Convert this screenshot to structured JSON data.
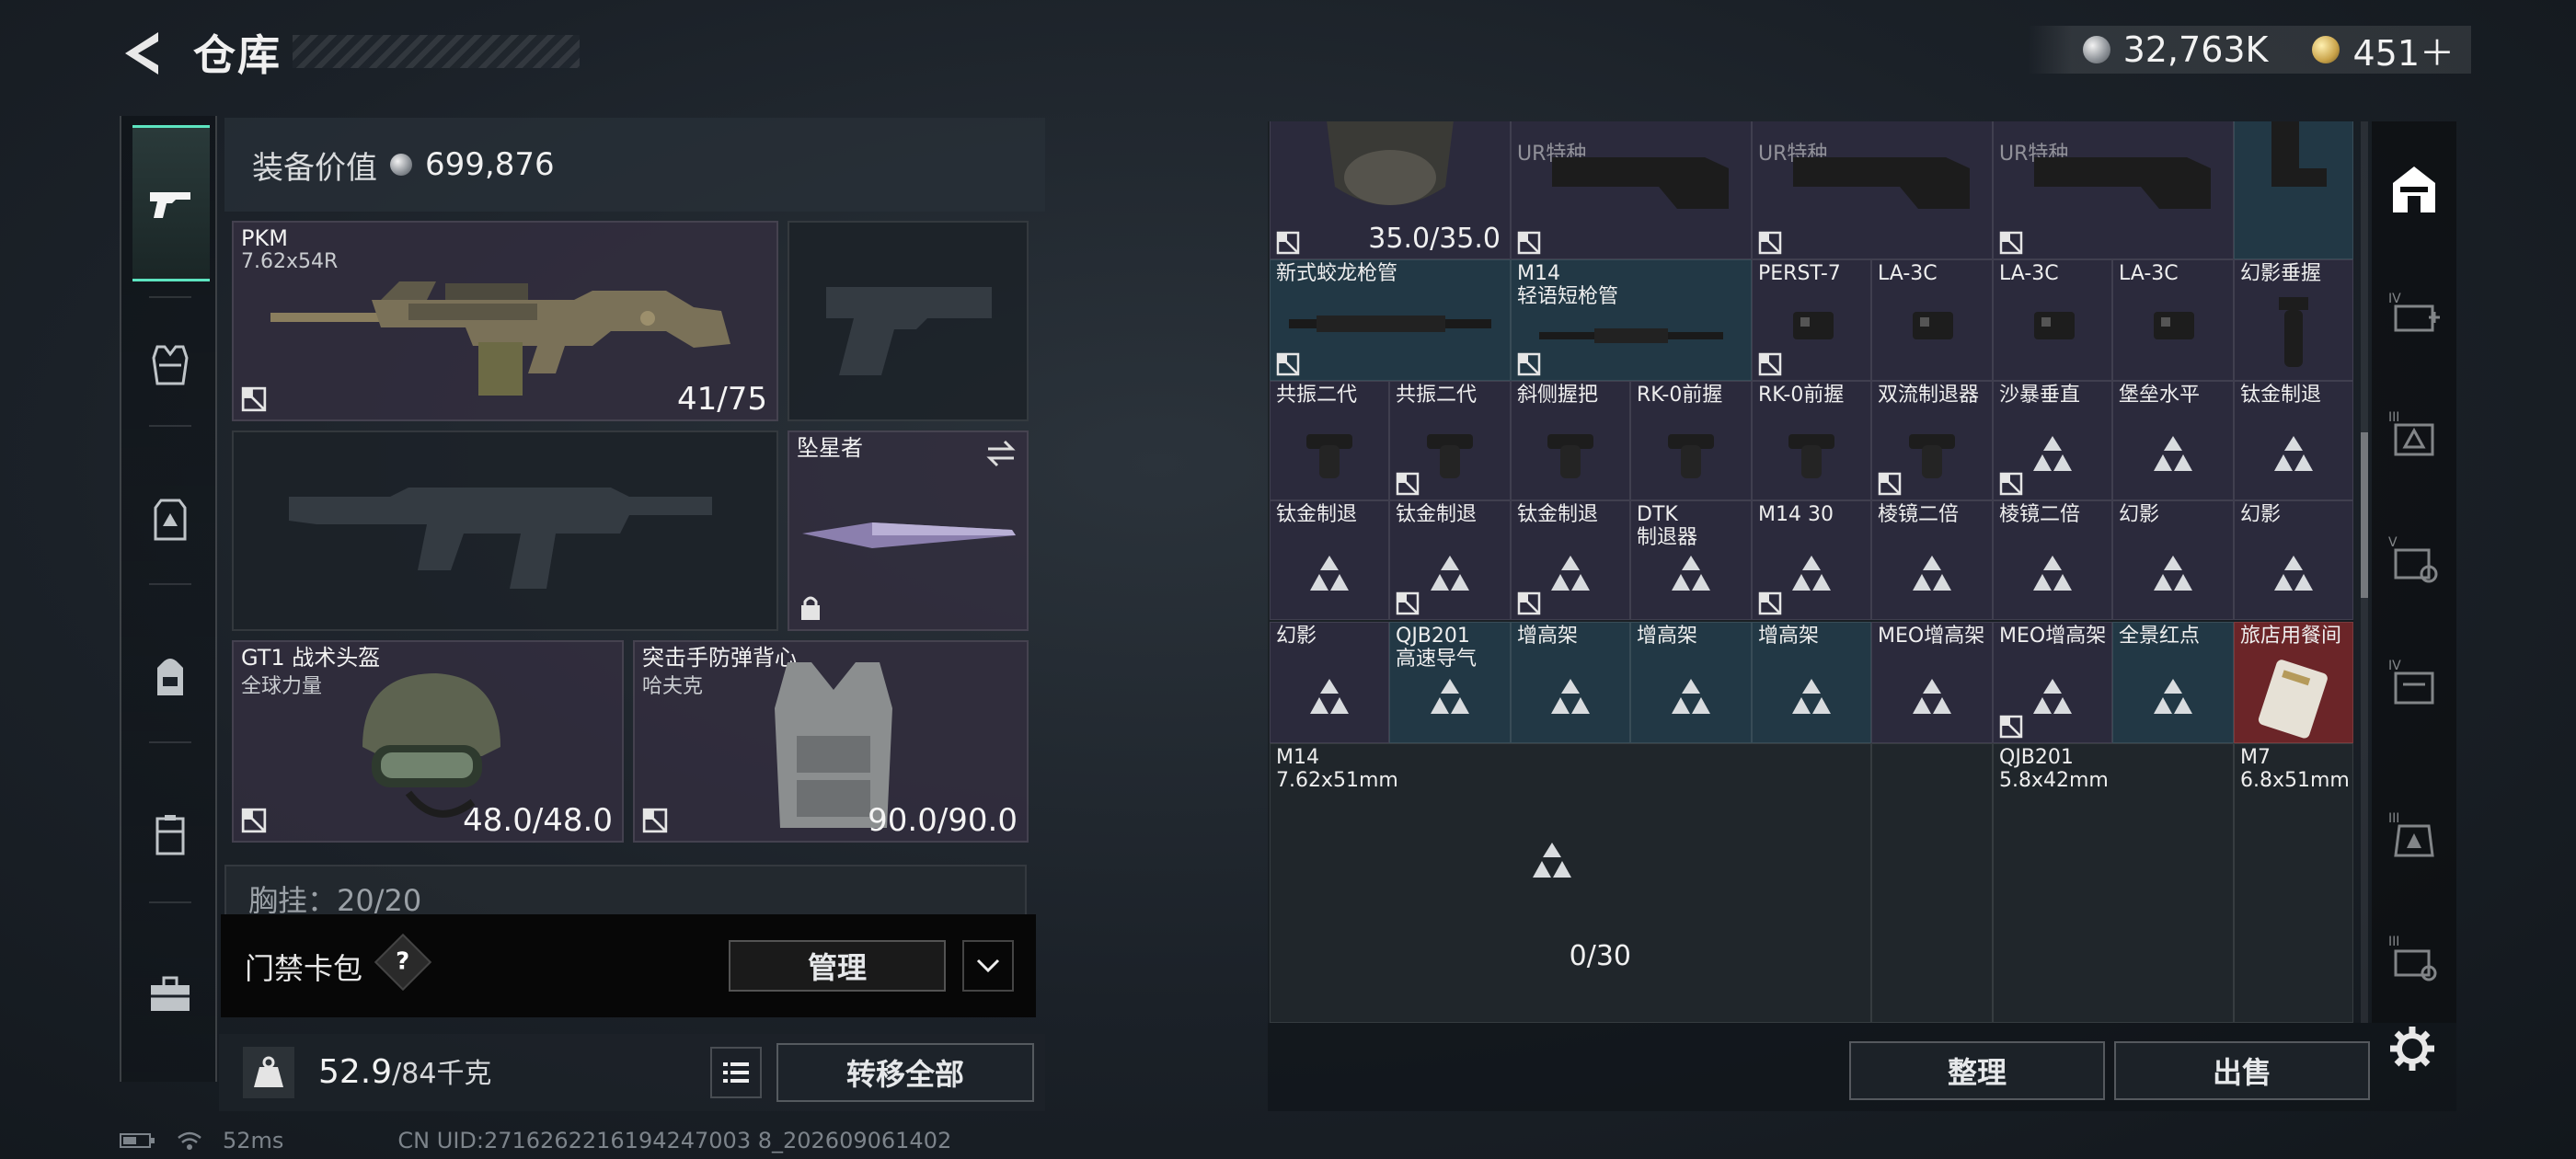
{
  "header": {
    "title": "仓库",
    "currency": [
      {
        "type": "silver",
        "value": "32,763K"
      },
      {
        "type": "gold",
        "value": "451＋"
      }
    ]
  },
  "left_nav": [
    "pistol-icon",
    "armor-icon",
    "chest-rig-icon",
    "backpack-icon",
    "case-icon",
    "toolbox-icon"
  ],
  "equipment": {
    "value_label": "装备价值",
    "value": "699,876",
    "slots": {
      "primary": {
        "name": "PKM",
        "sub": "7.62x54R",
        "count": "41/75"
      },
      "melee": {
        "name": "坠星者"
      },
      "helmet": {
        "name": "GT1 战术头盔",
        "sub": "全球力量",
        "count": "48.0/48.0"
      },
      "vest": {
        "name": "突击手防弹背心",
        "sub": "哈夫克",
        "count": "90.0/90.0"
      }
    },
    "chest_label": "胸挂：20/20",
    "keycard_label": "门禁卡包",
    "help": "?",
    "manage_label": "管理",
    "weight_value": "52.9",
    "weight_max": "/84千克",
    "transfer_label": "转移全部"
  },
  "status": {
    "ping": "52ms",
    "uid": "CN UID:2716262216194247003 8_202609061402"
  },
  "inventory": {
    "row0": [
      {
        "tag": "",
        "count": "35.0/35.0"
      },
      {
        "tag": "UR特种"
      },
      {
        "tag": "UR特种"
      },
      {
        "tag": "UR特种"
      },
      {
        "tag": ""
      }
    ],
    "row1": [
      {
        "name": "新式蛟龙枪管"
      },
      {
        "name": "M14\n轻语短枪管"
      },
      {
        "name": "PERST-7"
      },
      {
        "name": "LA-3C"
      },
      {
        "name": "LA-3C"
      },
      {
        "name": "LA-3C"
      },
      {
        "name": "幻影垂握"
      }
    ],
    "row2": [
      "共振二代",
      "共振二代",
      "斜侧握把",
      "RK-0前握",
      "RK-0前握",
      "双流制退器",
      "沙暴垂直",
      "堡垒水平",
      "钛金制退"
    ],
    "row3": [
      "钛金制退",
      "钛金制退",
      "钛金制退",
      "DTK\n制退器",
      "M14 30",
      "棱镜二倍",
      "棱镜二倍",
      "幻影",
      "幻影"
    ],
    "row4": [
      "幻影",
      "QJB201\n高速导气",
      "增高架",
      "增高架",
      "增高架",
      "MEO增高架",
      "MEO增高架",
      "全景红点",
      "旅店用餐间"
    ],
    "ammo": [
      {
        "name": "M14\n7.62x51mm",
        "count": "0/30"
      },
      {
        "name": "QJB201\n5.8x42mm"
      },
      {
        "name": "M7\n6.8x51mm"
      }
    ]
  },
  "filters": [
    "all-icon",
    "medical-4-icon",
    "ammo-3-icon",
    "gear-5-icon",
    "mod-4-icon",
    "armor-3-icon",
    "key-3-icon"
  ],
  "actions": {
    "sort_label": "整理",
    "sell_label": "出售"
  },
  "colors": {
    "accent": "#5de4c0",
    "rarity_purple": "#2b2a3c",
    "rarity_blue": "#223845",
    "rarity_red": "#6b2528"
  }
}
